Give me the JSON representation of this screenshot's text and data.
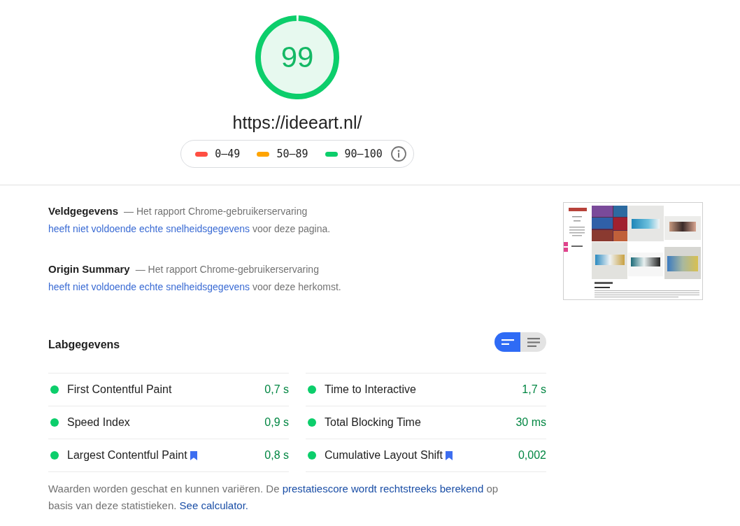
{
  "gauge": {
    "score": "99",
    "level": 0.99
  },
  "url": "https://ideeart.nl/",
  "legend": [
    {
      "range": "0–49",
      "color": "#ff4e42"
    },
    {
      "range": "50–89",
      "color": "#ffa400"
    },
    {
      "range": "90–100",
      "color": "#0cce6b"
    }
  ],
  "field_data": [
    {
      "title": "Veldgegevens",
      "parts": [
        {
          "kind": "text",
          "text": "— Het rapport Chrome-gebruikerservaring"
        },
        {
          "kind": "link",
          "text": "heeft niet voldoende echte snelheidsgegevens"
        },
        {
          "kind": "text",
          "text": "voor deze pagina."
        }
      ]
    },
    {
      "title": "Origin Summary",
      "parts": [
        {
          "kind": "text",
          "text": "— Het rapport Chrome-gebruikerservaring"
        },
        {
          "kind": "link",
          "text": "heeft niet voldoende echte snelheidsgegevens"
        },
        {
          "kind": "text",
          "text": "voor deze herkomst."
        }
      ]
    }
  ],
  "lab_data": {
    "title": "Labgegevens",
    "view_toggle": [
      {
        "kind": "two-line",
        "selected": true
      },
      {
        "kind": "three-line",
        "selected": false
      }
    ],
    "metrics": [
      {
        "label": "First Contentful Paint",
        "value": "0,7 s",
        "color": "#0cce6b",
        "bookmark": false
      },
      {
        "label": "Time to Interactive",
        "value": "1,7 s",
        "color": "#0cce6b",
        "bookmark": false
      },
      {
        "label": "Speed Index",
        "value": "0,9 s",
        "color": "#0cce6b",
        "bookmark": false
      },
      {
        "label": "Total Blocking Time",
        "value": "30 ms",
        "color": "#0cce6b",
        "bookmark": false
      },
      {
        "label": "Largest Contentful Paint",
        "value": "0,8 s",
        "color": "#0cce6b",
        "bookmark": true
      },
      {
        "label": "Cumulative Layout Shift",
        "value": "0,002",
        "color": "#0cce6b",
        "bookmark": true
      }
    ]
  },
  "footer": {
    "parts": [
      {
        "kind": "text",
        "text": "Waarden worden geschat en kunnen variëren. De"
      },
      {
        "kind": "link",
        "text": "prestatiescore wordt rechtstreeks berekend"
      },
      {
        "kind": "text",
        "text": "op basis van deze statistieken."
      },
      {
        "kind": "link",
        "text": "See calculator."
      }
    ]
  }
}
